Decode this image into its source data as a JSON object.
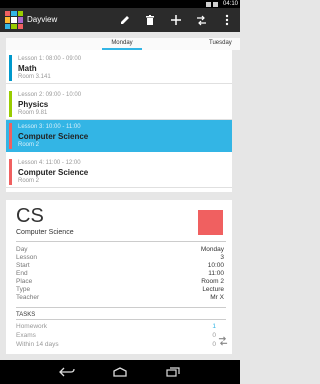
{
  "status": {
    "time": "04:10"
  },
  "app": {
    "title": "Dayview",
    "logo_colors": [
      "#f06060",
      "#33b5e5",
      "#99cc00",
      "#ffbb33",
      "#ffffff",
      "#aa66cc",
      "#33b5e5",
      "#99cc00",
      "#f06060"
    ],
    "actions": [
      {
        "name": "edit-button",
        "icon": "pencil-icon"
      },
      {
        "name": "delete-button",
        "icon": "trash-icon"
      },
      {
        "name": "add-button",
        "icon": "plus-icon"
      },
      {
        "name": "swap-button",
        "icon": "swap-icon"
      },
      {
        "name": "overflow-menu-button",
        "icon": "more-vert-icon"
      }
    ]
  },
  "tabs": {
    "current": "Monday",
    "next": "Tuesday",
    "accent": "#33b5e5"
  },
  "lessons": [
    {
      "time": "Lesson 1: 08:00 - 09:00",
      "subject": "Math",
      "room": "Room 3.141",
      "color": "#0099cc",
      "selected": false
    },
    {
      "time": "Lesson 2: 09:00 - 10:00",
      "subject": "Physics",
      "room": "Room 9.81",
      "color": "#99cc00",
      "selected": false
    },
    {
      "time": "Lesson 3: 10:00 - 11:00",
      "subject": "Computer Science",
      "room": "Room 2",
      "color": "#f06060",
      "selected": true
    },
    {
      "time": "Lesson 4: 11:00 - 12:00",
      "subject": "Computer Science",
      "room": "Room 2",
      "color": "#f06060",
      "selected": false
    }
  ],
  "detail": {
    "abbreviation": "CS",
    "subject": "Computer Science",
    "color": "#f06060",
    "rows": [
      {
        "label": "Day",
        "value": "Monday"
      },
      {
        "label": "Lesson",
        "value": "3"
      },
      {
        "label": "Start",
        "value": "10:00"
      },
      {
        "label": "End",
        "value": "11:00"
      },
      {
        "label": "Place",
        "value": "Room 2"
      },
      {
        "label": "Type",
        "value": "Lecture"
      },
      {
        "label": "Teacher",
        "value": "Mr X"
      }
    ],
    "tasks_title": "TASKS",
    "tasks": [
      {
        "label": "Homework",
        "value": "1"
      },
      {
        "label": "Exams",
        "value": "0"
      },
      {
        "label": "Within 14 days",
        "value": "0"
      }
    ]
  }
}
